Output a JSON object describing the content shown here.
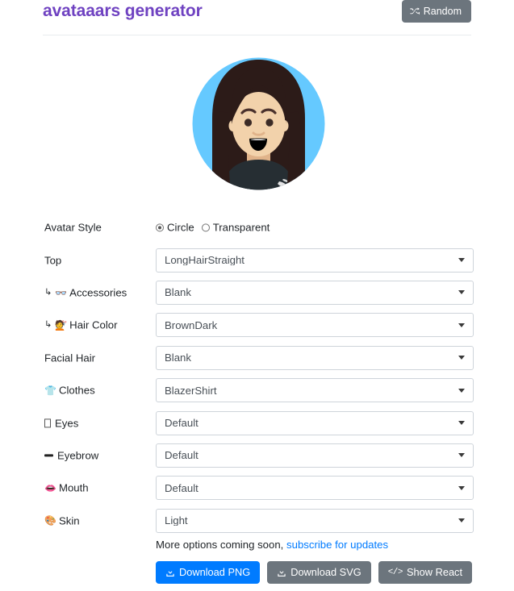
{
  "header": {
    "title": "avataaars generator",
    "random_label": "Random",
    "random_icon": "shuffle-icon"
  },
  "avatar": {
    "style": "Circle",
    "circle_bg": "#65c9ff",
    "skin_color": "#f4d0a8",
    "hair_color": "#4a312c",
    "clothes_color": "#262e33",
    "mouth_color": "#000000",
    "eye_color": "#4a312c"
  },
  "form": {
    "rows": [
      {
        "label": "Avatar Style",
        "icon": "",
        "sub": false,
        "type": "radio",
        "options": [
          {
            "label": "Circle",
            "selected": true
          },
          {
            "label": "Transparent",
            "selected": false
          }
        ]
      },
      {
        "label": "Top",
        "icon": "",
        "sub": false,
        "type": "select",
        "value": "LongHairStraight"
      },
      {
        "label": "Accessories",
        "icon": "glasses-icon",
        "sub": true,
        "type": "select",
        "value": "Blank"
      },
      {
        "label": "Hair Color",
        "icon": "hair-dye-icon",
        "sub": true,
        "type": "select",
        "value": "BrownDark"
      },
      {
        "label": "Facial Hair",
        "icon": "",
        "sub": false,
        "type": "select",
        "value": "Blank"
      },
      {
        "label": "Clothes",
        "icon": "tshirt-icon",
        "sub": false,
        "type": "select",
        "value": "BlazerShirt"
      },
      {
        "label": "Eyes",
        "icon": "eyes-icon",
        "sub": false,
        "type": "select",
        "value": "Default"
      },
      {
        "label": "Eyebrow",
        "icon": "eyebrow-icon",
        "sub": false,
        "type": "select",
        "value": "Default"
      },
      {
        "label": "Mouth",
        "icon": "mouth-icon",
        "sub": false,
        "type": "select",
        "value": "Default"
      },
      {
        "label": "Skin",
        "icon": "palette-icon",
        "sub": false,
        "type": "select",
        "value": "Light"
      }
    ]
  },
  "footer": {
    "note_text": "More options coming soon,",
    "note_link": "subscribe for updates",
    "buttons": [
      {
        "label": "Download PNG",
        "icon": "download-icon",
        "style": "primary"
      },
      {
        "label": "Download SVG",
        "icon": "download-icon",
        "style": "secondary"
      },
      {
        "label": "Show React",
        "icon": "code-icon",
        "style": "secondary"
      }
    ]
  },
  "colors": {
    "brand_purple": "#6f42c1",
    "primary_blue": "#007bff",
    "secondary_gray": "#6c757d",
    "link_blue": "#007bff"
  }
}
